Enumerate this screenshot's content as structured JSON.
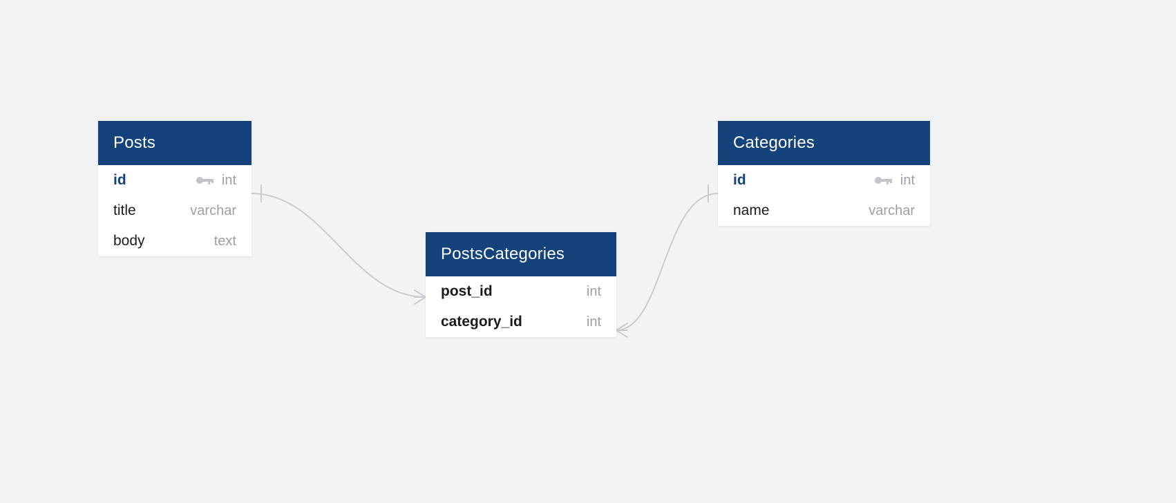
{
  "entities": {
    "posts": {
      "title": "Posts",
      "columns": [
        {
          "name": "id",
          "type": "int",
          "pk": true
        },
        {
          "name": "title",
          "type": "varchar",
          "pk": false
        },
        {
          "name": "body",
          "type": "text",
          "pk": false
        }
      ]
    },
    "postscategories": {
      "title": "PostsCategories",
      "columns": [
        {
          "name": "post_id",
          "type": "int",
          "fk": true
        },
        {
          "name": "category_id",
          "type": "int",
          "fk": true
        }
      ]
    },
    "categories": {
      "title": "Categories",
      "columns": [
        {
          "name": "id",
          "type": "int",
          "pk": true
        },
        {
          "name": "name",
          "type": "varchar",
          "pk": false
        }
      ]
    }
  },
  "relationships": [
    {
      "from": "Posts.id",
      "to": "PostsCategories.post_id",
      "from_card": "one",
      "to_card": "many"
    },
    {
      "from": "Categories.id",
      "to": "PostsCategories.category_id",
      "from_card": "one",
      "to_card": "many"
    }
  ]
}
